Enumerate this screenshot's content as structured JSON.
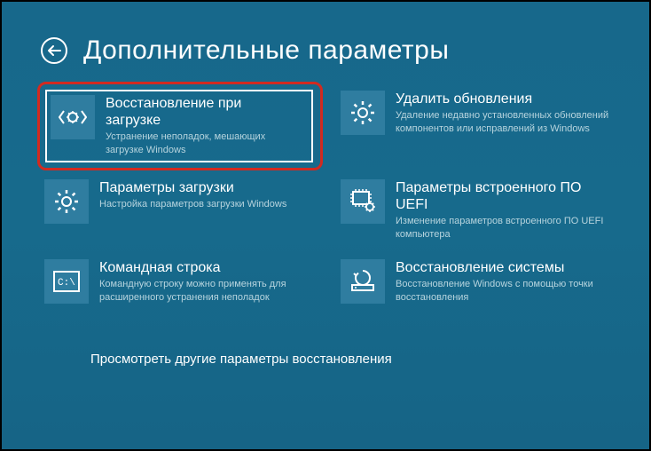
{
  "header": {
    "title": "Дополнительные параметры"
  },
  "tiles": [
    {
      "label": "Восстановление при загрузке",
      "desc": "Устранение неполадок, мешающих загрузке Windows"
    },
    {
      "label": "Удалить обновления",
      "desc": "Удаление недавно установленных обновлений компонентов или исправлений из Windows"
    },
    {
      "label": "Параметры загрузки",
      "desc": "Настройка параметров загрузки Windows"
    },
    {
      "label": "Параметры встроенного ПО UEFI",
      "desc": "Изменение параметров встроенного ПО UEFI компьютера"
    },
    {
      "label": "Командная строка",
      "desc": "Командную строку можно применять для расширенного устранения неполадок"
    },
    {
      "label": "Восстановление системы",
      "desc": "Восстановление Windows с помощью точки восстановления"
    }
  ],
  "footer": {
    "more": "Просмотреть другие параметры восстановления"
  }
}
